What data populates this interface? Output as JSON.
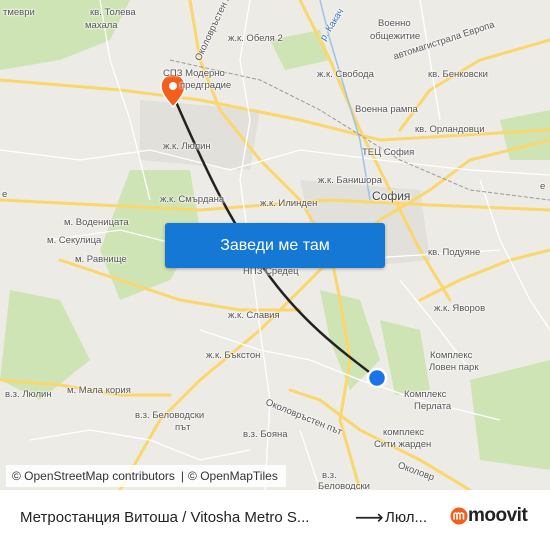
{
  "map": {
    "labels": [
      {
        "id": "tolevamahala1",
        "text": "кв. Толева"
      },
      {
        "id": "tolevamahala2",
        "text": "махала"
      },
      {
        "id": "tmevri",
        "text": "тмеври"
      },
      {
        "id": "sofia",
        "text": "София"
      },
      {
        "id": "ring_nw",
        "text": "Околовръстен път"
      },
      {
        "id": "obelya",
        "text": "ж.к. Обеля 2"
      },
      {
        "id": "kakach",
        "text": "р. Какач"
      },
      {
        "id": "voenno1",
        "text": "Военно"
      },
      {
        "id": "voenno2",
        "text": "общежитие"
      },
      {
        "id": "evropa",
        "text": "автомагистрала Европа"
      },
      {
        "id": "spz1",
        "text": "СПЗ Модерно"
      },
      {
        "id": "spz2",
        "text": "предградие"
      },
      {
        "id": "svoboda",
        "text": "ж.к. Свобода"
      },
      {
        "id": "benkovski",
        "text": "кв. Бенковски"
      },
      {
        "id": "voennarampa",
        "text": "Военна рампа"
      },
      {
        "id": "orlandovtsi",
        "text": "кв. Орландовци"
      },
      {
        "id": "lyulin",
        "text": "ж.к. Люлин"
      },
      {
        "id": "tets",
        "text": "ТЕЦ София"
      },
      {
        "id": "banishora",
        "text": "ж.к. Банишора"
      },
      {
        "id": "smyrdana",
        "text": "ж.к. Смърдана"
      },
      {
        "id": "ilinden",
        "text": "ж.к. Илинден"
      },
      {
        "id": "vodenitsata",
        "text": "м. Воденицата"
      },
      {
        "id": "sekulitsa",
        "text": "м. Секулица"
      },
      {
        "id": "ravnishte",
        "text": "м. Равнище"
      },
      {
        "id": "podujane",
        "text": "кв. Подуяне"
      },
      {
        "id": "sredets",
        "text": "НПЗ Средец"
      },
      {
        "id": "yavorov",
        "text": "ж.к. Яворов"
      },
      {
        "id": "slavia",
        "text": "ж.к. Славия"
      },
      {
        "id": "loven1",
        "text": "Комплекс"
      },
      {
        "id": "loven2",
        "text": "Ловен парк"
      },
      {
        "id": "bakston",
        "text": "ж.к. Бъкстон"
      },
      {
        "id": "perlata1",
        "text": "Комплекс"
      },
      {
        "id": "perlata2",
        "text": "Перлата"
      },
      {
        "id": "vzlyulin",
        "text": "в.з. Люлин"
      },
      {
        "id": "malakoria",
        "text": "м. Мала кория"
      },
      {
        "id": "belovodski1",
        "text": "в.з. Беловодски"
      },
      {
        "id": "belovodski2",
        "text": "път"
      },
      {
        "id": "boyana",
        "text": "в.з. Бояна"
      },
      {
        "id": "sitigarden1",
        "text": "комплекс"
      },
      {
        "id": "sitigarden2",
        "text": "Сити жарден"
      },
      {
        "id": "ring_s",
        "text": "Околовръстен път"
      },
      {
        "id": "ring_se",
        "text": "Околовр"
      },
      {
        "id": "vz1",
        "text": "в.з."
      },
      {
        "id": "vz2",
        "text": "Беловодски"
      },
      {
        "id": "e1",
        "text": "е"
      },
      {
        "id": "e2",
        "text": "е"
      }
    ],
    "button": "Заведи ме там",
    "attribution": {
      "osm1": "© OpenStreetMap contributors",
      "sep": "|",
      "osm2": "© OpenMapTiles"
    },
    "colors": {
      "route": "#222222",
      "origin": "#1a73e8",
      "destination": "#f45d1a",
      "park": "#cfe4b5",
      "road": "#fbd66b",
      "button": "#1478d4"
    }
  },
  "footer": {
    "route_text": "Метростанция Витоша / Vitosha Metro S...",
    "destination": "Люл...",
    "brand": "moovit"
  }
}
